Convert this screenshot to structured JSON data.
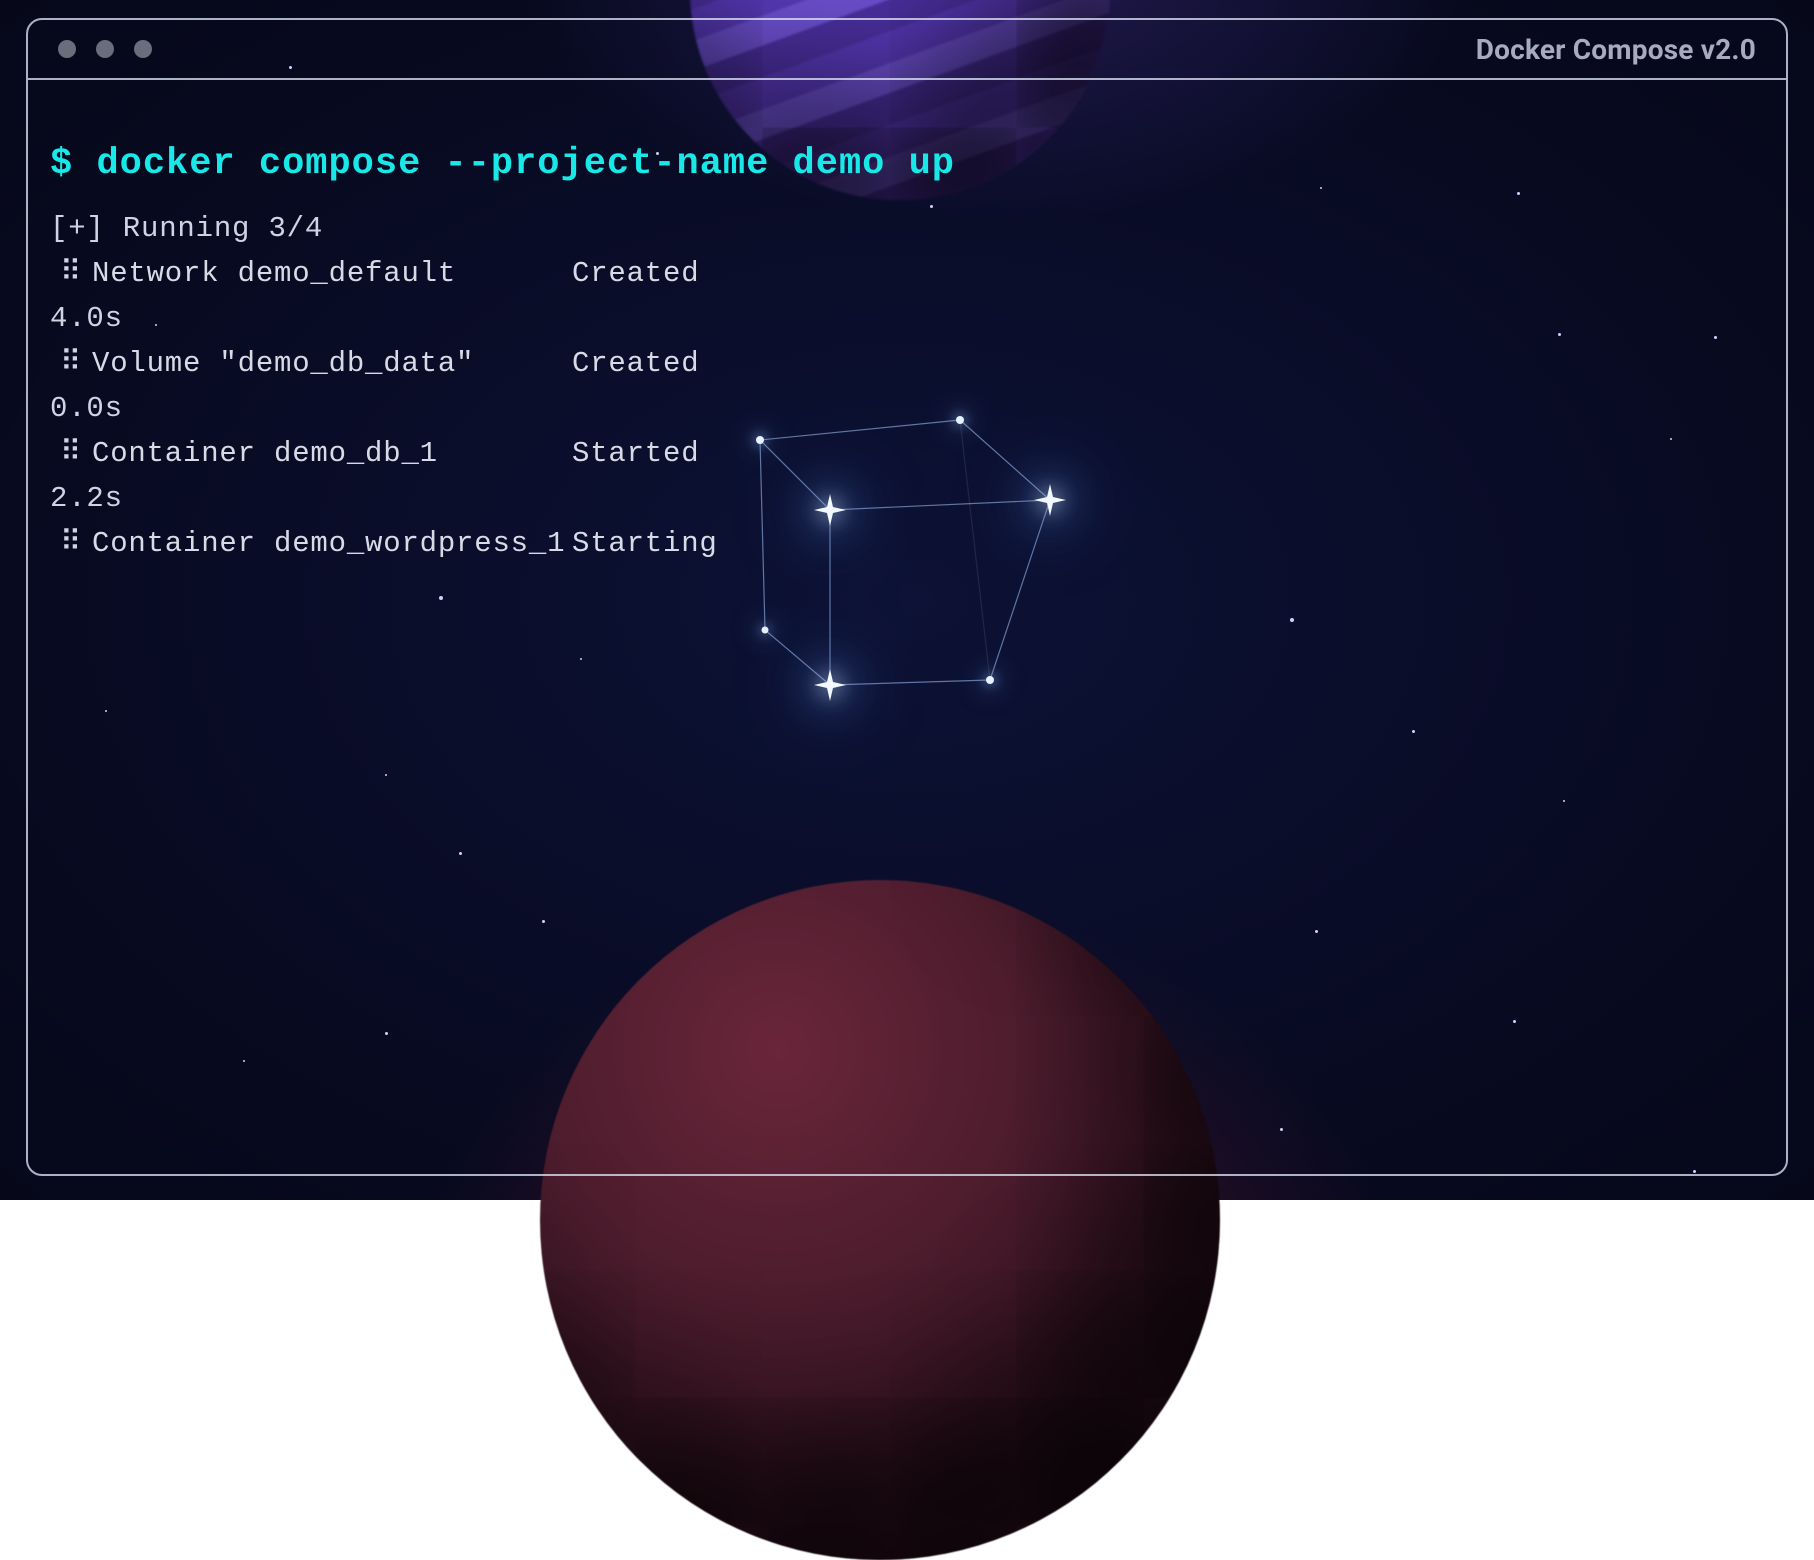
{
  "window": {
    "title": "Docker Compose v2.0"
  },
  "terminal": {
    "prompt": "$",
    "command": "docker compose --project-name demo up",
    "status_prefix": "[+] Running",
    "status_count": "3/4",
    "spinner_glyph": "⠿",
    "rows": [
      {
        "name": "Network demo_default",
        "state": "Created",
        "time": "4.0s"
      },
      {
        "name": "Volume \"demo_db_data\"",
        "state": "Created",
        "time": "0.0s"
      },
      {
        "name": "Container demo_db_1",
        "state": "Started",
        "time": "2.2s"
      },
      {
        "name": "Container demo_wordpress_1",
        "state": "Starting",
        "time": ""
      }
    ]
  }
}
